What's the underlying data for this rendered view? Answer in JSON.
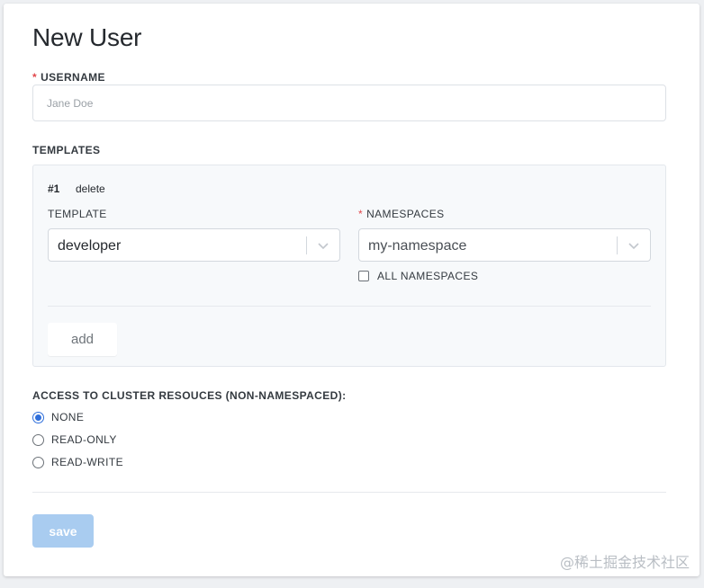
{
  "page": {
    "title": "New User"
  },
  "username": {
    "required_mark": "*",
    "label": "USERNAME",
    "placeholder": "Jane Doe",
    "value": ""
  },
  "templates": {
    "label": "TEMPLATES",
    "items": [
      {
        "index": "#1",
        "delete_label": "delete",
        "template_label": "TEMPLATE",
        "template_value": "developer",
        "namespaces_required_mark": "*",
        "namespaces_label": "NAMESPACES",
        "namespaces_value": "my-namespace",
        "all_namespaces_label": "ALL NAMESPACES",
        "all_namespaces_checked": false
      }
    ],
    "add_label": "add"
  },
  "access": {
    "label": "ACCESS TO CLUSTER RESOUCES (NON-NAMESPACED):",
    "options": [
      {
        "label": "NONE",
        "checked": true
      },
      {
        "label": "READ-ONLY",
        "checked": false
      },
      {
        "label": "READ-WRITE",
        "checked": false
      }
    ]
  },
  "actions": {
    "save_label": "save"
  },
  "watermark": {
    "text": "@稀土掘金技术社区"
  },
  "colors": {
    "accent": "#2f6fdb",
    "save_disabled": "#a9ccf0",
    "required": "#e2474b"
  },
  "icons": {
    "select_chevron": "chevron-down-icon"
  }
}
